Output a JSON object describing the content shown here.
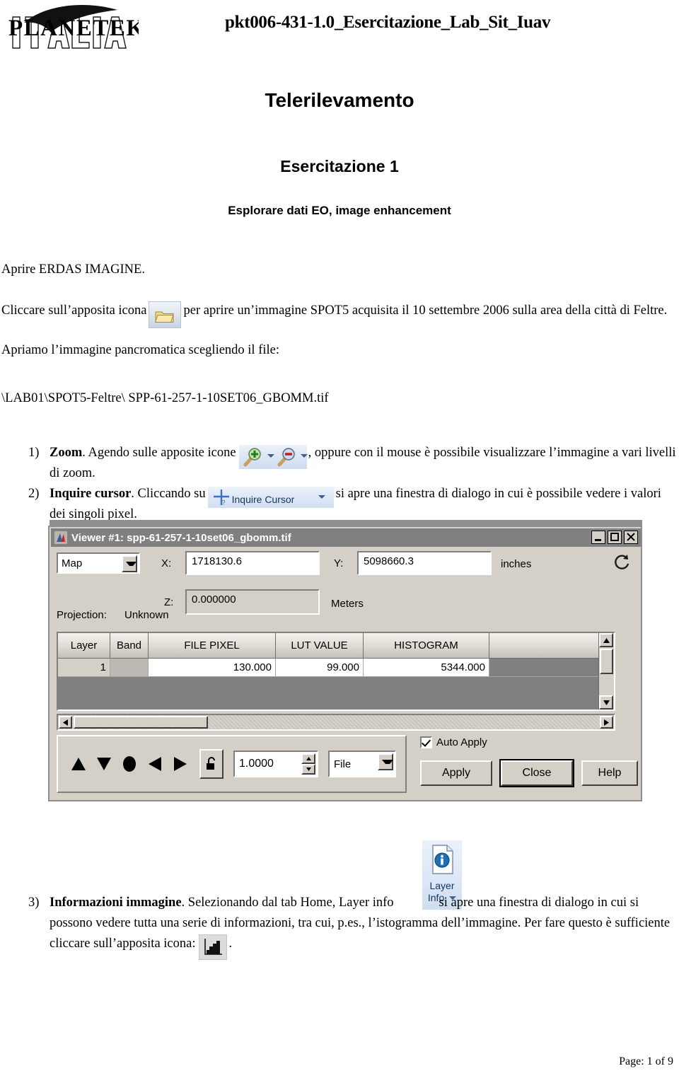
{
  "header": {
    "logo_primary": "PLANETEK",
    "logo_secondary": "ITALIA",
    "doc_code": "pkt006-431-1.0_Esercitazione_Lab_Sit_Iuav"
  },
  "titles": {
    "main": "Telerilevamento",
    "sub": "Esercitazione 1",
    "sub2": "Esplorare dati EO, image enhancement"
  },
  "body": {
    "open_app": "Aprire ERDAS IMAGINE.",
    "click_icon_before": "Cliccare sull’apposita icona",
    "click_icon_after": "per aprire un’immagine SPOT5 acquisita il 10 settembre 2006 sulla area della città di Feltre.",
    "open_pan": "Apriamo l’immagine pancromatica scegliendo il file:",
    "file_path": "\\LAB01\\SPOT5-Feltre\\ SPP-61-257-1-10SET06_GBOMM.tif"
  },
  "steps": [
    {
      "number": "1)",
      "title": "Zoom",
      "text_before": ". Agendo sulle apposite icone",
      "text_after": ", oppure con il mouse è possibile visualizzare l’immagine a vari livelli di zoom."
    },
    {
      "number": "2)",
      "title": "Inquire cursor",
      "text_before": ". Cliccando su",
      "text_after": "si apre una finestra di dialogo in cui è possibile vedere i valori dei singoli pixel."
    },
    {
      "number": "3)",
      "title": "Informazioni immagine",
      "text_before": ". Selezionando dal tab Home, Layer info",
      "text_after": "si apre una finestra di dialogo in cui si possono vedere tutta una serie di informazioni, tra cui, p.es., l’istogramma dell’immagine. Per fare questo è sufficiente cliccare sull’apposita icona:",
      "text_end": "."
    }
  ],
  "ribbon": {
    "inquire_cursor_label": "Inquire Cursor",
    "layer_info_line1": "Layer",
    "layer_info_line2": "Info"
  },
  "dialog": {
    "title": "Viewer #1:  spp-61-257-1-10set06_gbomm.tif",
    "window_controls": {
      "minimize": "_",
      "maximize": "□",
      "close": "×"
    },
    "coord_system": "Map",
    "x_label": "X:",
    "x_value": "1718130.6",
    "y_label": "Y:",
    "y_value": "5098660.3",
    "xy_units": "inches",
    "z_label": "Z:",
    "z_value": "0.000000",
    "z_units": "Meters",
    "projection_label": "Projection:",
    "projection_value": "Unknown",
    "table": {
      "headers": [
        "Layer",
        "Band",
        "FILE PIXEL",
        "LUT VALUE",
        "HISTOGRAM",
        ""
      ],
      "rows": [
        [
          "1",
          "",
          "130.000",
          "99.000",
          "5344.000",
          ""
        ]
      ]
    },
    "zoom_value": "1.0000",
    "source_select": "File",
    "auto_apply_label": "Auto Apply",
    "apply_button": "Apply",
    "close_button": "Close",
    "help_button": "Help"
  },
  "footer": {
    "page": "Page: 1 of  9"
  },
  "colors": {
    "dialog_face": "#d4d0c8",
    "titlebar": "#808080",
    "ribbon_blue": "#dbe5f4",
    "ribbon_text": "#14345c"
  }
}
